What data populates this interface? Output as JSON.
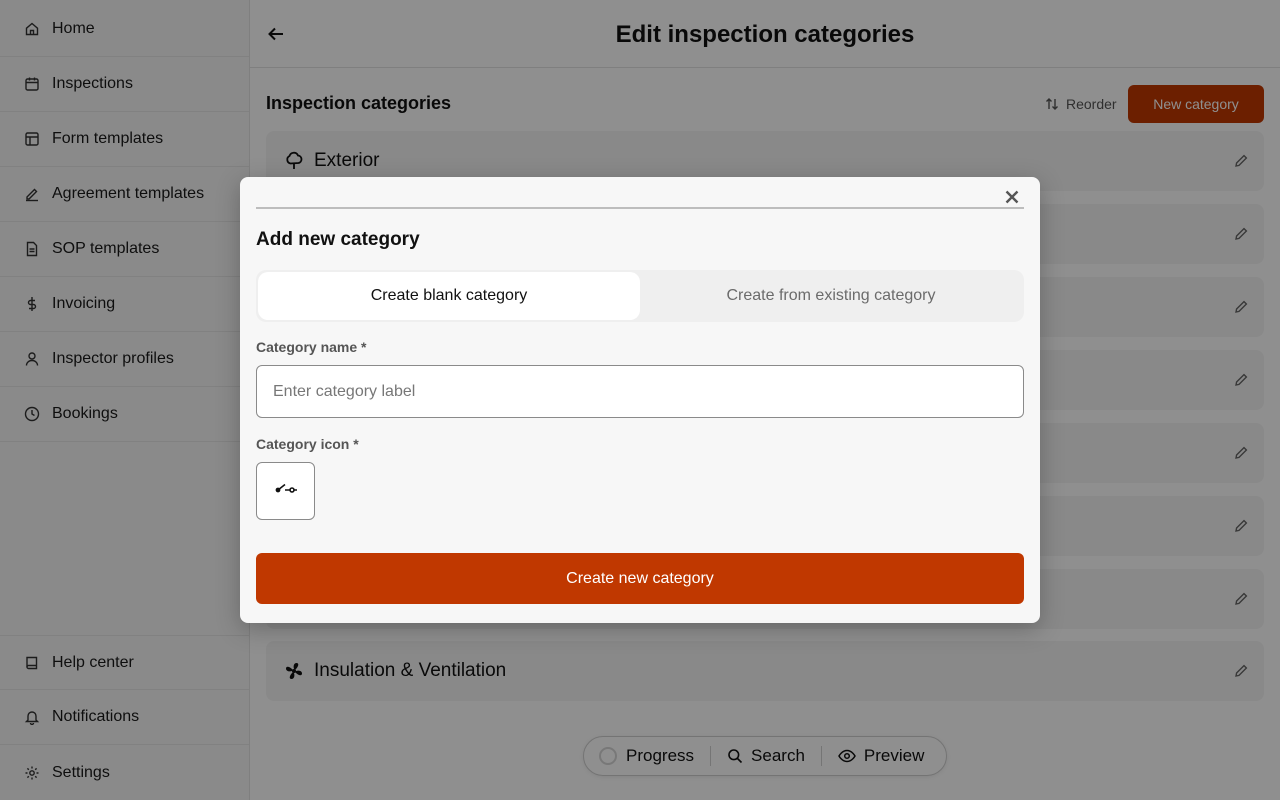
{
  "sidebar": {
    "items": [
      {
        "label": "Home",
        "icon": "home-icon"
      },
      {
        "label": "Inspections",
        "icon": "calendar-icon"
      },
      {
        "label": "Form templates",
        "icon": "layout-icon"
      },
      {
        "label": "Agreement templates",
        "icon": "signature-icon"
      },
      {
        "label": "SOP templates",
        "icon": "document-icon"
      },
      {
        "label": "Invoicing",
        "icon": "dollar-icon"
      },
      {
        "label": "Inspector profiles",
        "icon": "user-icon"
      },
      {
        "label": "Bookings",
        "icon": "clock-icon"
      }
    ],
    "bottom_items": [
      {
        "label": "Help center",
        "icon": "book-icon"
      },
      {
        "label": "Notifications",
        "icon": "bell-icon"
      },
      {
        "label": "Settings",
        "icon": "gear-icon"
      }
    ]
  },
  "header": {
    "title": "Edit inspection categories"
  },
  "main": {
    "section_title": "Inspection categories",
    "reorder_label": "Reorder",
    "new_category_label": "New category",
    "categories": [
      {
        "label": "Exterior",
        "icon": "tree-icon"
      },
      {
        "label": "Insulation & Ventilation",
        "icon": "fan-icon"
      }
    ]
  },
  "bottom_bar": {
    "progress_label": "Progress",
    "search_label": "Search",
    "preview_label": "Preview"
  },
  "modal": {
    "title": "Add new category",
    "tabs": [
      {
        "label": "Create blank category",
        "active": true
      },
      {
        "label": "Create from existing category",
        "active": false
      }
    ],
    "name_label": "Category name *",
    "name_value": "",
    "name_placeholder": "Enter category label",
    "icon_label": "Category icon *",
    "selected_icon": "switch-icon",
    "submit_label": "Create new category"
  },
  "colors": {
    "accent": "#c03800",
    "overlay": "rgba(0,0,0,0.44)"
  }
}
